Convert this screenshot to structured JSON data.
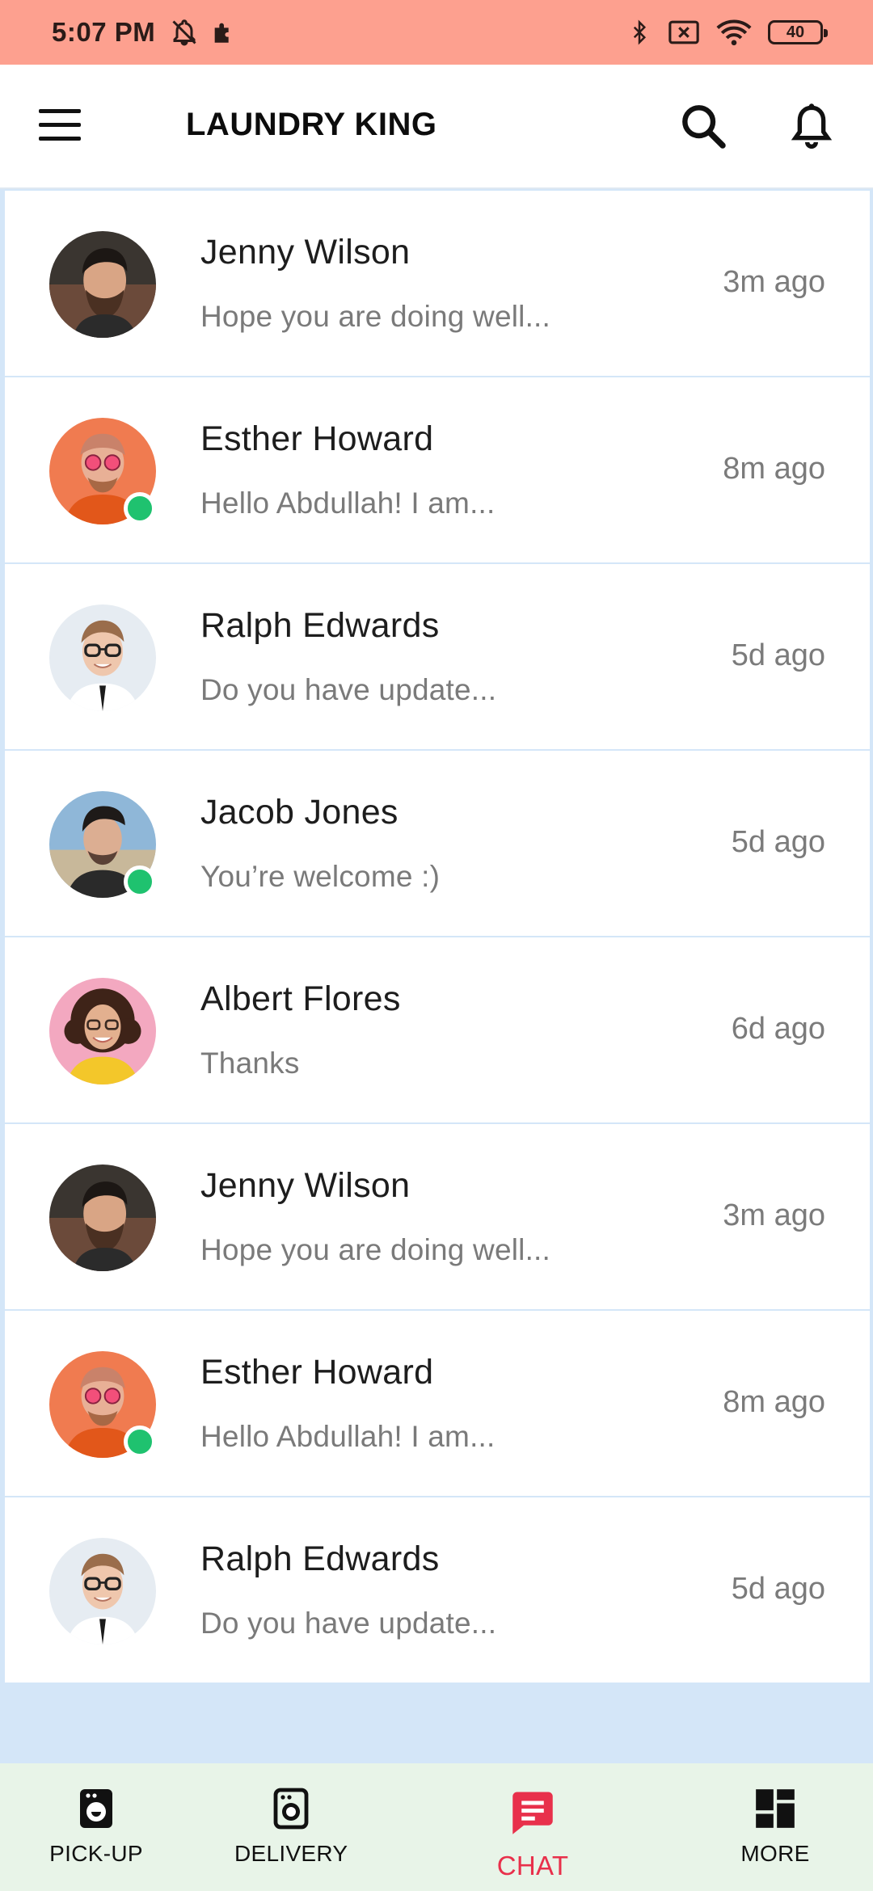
{
  "status_bar": {
    "time": "5:07 PM",
    "battery": "40",
    "icons": [
      "bell-off-icon",
      "puzzle-icon",
      "bluetooth-icon",
      "no-sim-icon",
      "wifi-icon",
      "battery-icon"
    ]
  },
  "app_bar": {
    "title": "LAUNDRY KING",
    "icons": [
      "menu-icon",
      "search-icon",
      "bell-icon"
    ]
  },
  "chats": [
    {
      "name": "Jenny Wilson",
      "message": "Hope you are doing well...",
      "time": "3m ago",
      "online": false,
      "avatar": "bearded-man"
    },
    {
      "name": "Esther Howard",
      "message": "Hello Abdullah! I am...",
      "time": "8m ago",
      "online": true,
      "avatar": "orange-jacket-man"
    },
    {
      "name": "Ralph Edwards",
      "message": "Do you have update...",
      "time": "5d ago",
      "online": false,
      "avatar": "glasses-man"
    },
    {
      "name": "Jacob Jones",
      "message": "You’re welcome :)",
      "time": "5d ago",
      "online": true,
      "avatar": "beach-man"
    },
    {
      "name": "Albert Flores",
      "message": "Thanks",
      "time": "6d ago",
      "online": false,
      "avatar": "curly-woman"
    },
    {
      "name": "Jenny Wilson",
      "message": "Hope you are doing well...",
      "time": "3m ago",
      "online": false,
      "avatar": "bearded-man"
    },
    {
      "name": "Esther Howard",
      "message": "Hello Abdullah! I am...",
      "time": "8m ago",
      "online": true,
      "avatar": "orange-jacket-man"
    },
    {
      "name": "Ralph Edwards",
      "message": "Do you have update...",
      "time": "5d ago",
      "online": false,
      "avatar": "glasses-man"
    }
  ],
  "bottom_nav": [
    {
      "label": "PICK-UP",
      "icon": "washing-machine-icon",
      "active": false
    },
    {
      "label": "DELIVERY",
      "icon": "washing-machine-icon",
      "active": false
    },
    {
      "label": "CHAT",
      "icon": "chat-icon",
      "active": true
    },
    {
      "label": "MORE",
      "icon": "grid-icon",
      "active": false
    }
  ],
  "colors": {
    "status_bar": "#fda08f",
    "online": "#1fc26f",
    "active_nav": "#e8304b",
    "nav_bg": "#e8f4e8",
    "list_bg": "#d4e6f8"
  }
}
